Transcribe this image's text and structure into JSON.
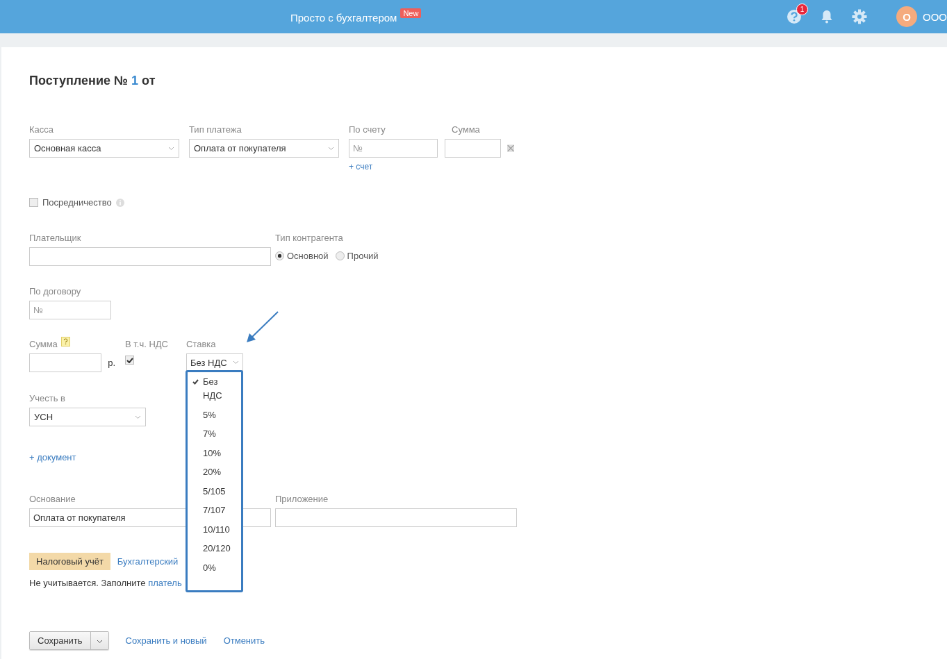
{
  "header": {
    "title": "Просто с бухгалтером",
    "badge": "New",
    "help_count": "1",
    "avatar_letter": "О",
    "org": "ООО"
  },
  "document": {
    "title": "Поступление №",
    "number": "1",
    "title_suffix": "от"
  },
  "kassa": {
    "label": "Касса",
    "value": "Основная касса"
  },
  "payment_type": {
    "label": "Тип платежа",
    "value": "Оплата от покупателя"
  },
  "invoice": {
    "label": "По счету",
    "placeholder": "№",
    "add_link": "+ счет"
  },
  "invoice_sum": {
    "label": "Сумма"
  },
  "mediation": {
    "label": "Посредничество",
    "checked": false
  },
  "payer": {
    "label": "Плательщик"
  },
  "counterparty_type": {
    "label": "Тип контрагента",
    "options": [
      {
        "label": "Основной",
        "selected": true
      },
      {
        "label": "Прочий",
        "selected": false
      }
    ]
  },
  "contract": {
    "label": "По договору",
    "placeholder": "№"
  },
  "amount": {
    "label": "Сумма",
    "unit": "р."
  },
  "vat_included": {
    "label": "В т.ч. НДС",
    "checked": true
  },
  "rate": {
    "label": "Ставка",
    "value": "Без НДС",
    "expanded": true,
    "options": [
      {
        "label": "Без НДС",
        "selected": true
      },
      {
        "label": "5%",
        "selected": false
      },
      {
        "label": "7%",
        "selected": false
      },
      {
        "label": "10%",
        "selected": false
      },
      {
        "label": "20%",
        "selected": false
      },
      {
        "label": "5/105",
        "selected": false
      },
      {
        "label": "7/107",
        "selected": false
      },
      {
        "label": "10/110",
        "selected": false
      },
      {
        "label": "20/120",
        "selected": false
      },
      {
        "label": "0%",
        "selected": false
      }
    ]
  },
  "account_in": {
    "label": "Учесть в",
    "value": "УСН"
  },
  "add_document": "+ документ",
  "basis": {
    "label": "Основание",
    "value": "Оплата от покупателя"
  },
  "attachment": {
    "label": "Приложение"
  },
  "tabs": [
    {
      "label": "Налоговый учёт",
      "selected": true
    },
    {
      "label": "Бухгалтерский",
      "selected": false
    }
  ],
  "note": {
    "text": "Не учитывается. Заполните",
    "link": "платель"
  },
  "actions": {
    "save": "Сохранить",
    "save_new": "Сохранить и новый",
    "cancel": "Отменить"
  }
}
